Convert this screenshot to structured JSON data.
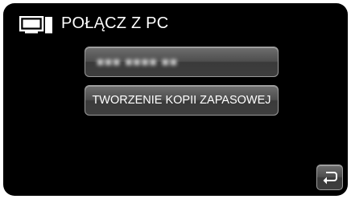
{
  "header": {
    "title": "POŁĄCZ Z PC",
    "icon": "pc-monitor-tower-icon"
  },
  "menu": {
    "device_name_label": "■■■ ■■■■ ■■",
    "backup_label": "TWORZENIE KOPII ZAPASOWEJ"
  },
  "navigation": {
    "back_icon": "return-arrow-icon"
  },
  "colors": {
    "background": "#000000",
    "button_top": "#6e6e6e",
    "button_bottom": "#3a3a3a",
    "text": "#ffffff"
  }
}
